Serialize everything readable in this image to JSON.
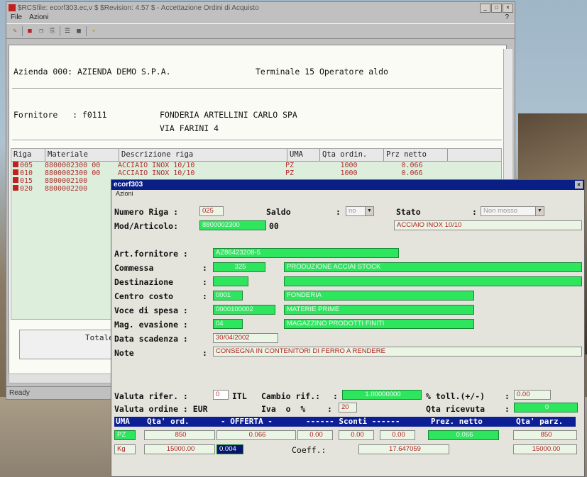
{
  "window": {
    "title": "$RCSfile: ecorf303.ec,v $ $Revision: 4.57 $ - Accettazione Ordini di Acquisto",
    "btn_min": "_",
    "btn_max": "□",
    "btn_close": "×",
    "help_mark": "?"
  },
  "menu": {
    "file": "File",
    "azioni": "Azioni"
  },
  "toolbar": {
    "icons": [
      "save-icon",
      "stop-icon",
      "copy-icon",
      "paste-icon",
      "find-icon",
      "grid-icon",
      "help-icon"
    ]
  },
  "header": {
    "azienda": "Azienda 000: AZIENDA DEMO S.P.A.",
    "terminale": "Terminale 15 Operatore aldo",
    "fornitore_label": "Fornitore   : f0111",
    "fornitore_name": "FONDERIA ARTELLINI CARLO SPA",
    "fornitore_addr": "VIA FARINI 4"
  },
  "grid": {
    "columns": [
      "Riga",
      "Materiale",
      "Descrizione riga",
      "UMA",
      "Qta ordin.",
      "Prz netto"
    ],
    "rows": [
      {
        "riga": "005",
        "materiale": "8800002300 00",
        "descr": "ACCIAIO INOX 10/10",
        "uma": "PZ",
        "qta": "1000",
        "prz": "0.066"
      },
      {
        "riga": "010",
        "materiale": "8800002300 00",
        "descr": "ACCIAIO INOX 10/10",
        "uma": "PZ",
        "qta": "1000",
        "prz": "0.066"
      },
      {
        "riga": "015",
        "materiale": "8800002100",
        "descr": "",
        "uma": "",
        "qta": "",
        "prz": ""
      },
      {
        "riga": "020",
        "materiale": "8800002200",
        "descr": "",
        "uma": "",
        "qta": "",
        "prz": ""
      }
    ],
    "totale": "Totale"
  },
  "status": "Ready",
  "dialog": {
    "title": "ecorf303",
    "menu": "Azioni",
    "close": "×",
    "numero_riga_label": "Numero Riga :",
    "numero_riga": "025",
    "saldo_label": "Saldo",
    "saldo": "no",
    "stato_label": "Stato",
    "stato": "Non mosso",
    "mod_label": "Mod/Articolo:",
    "mod_value": "8800002300",
    "mod_suffix": "00",
    "mod_desc": "ACCIAIO INOX 10/10",
    "art_label": "Art.fornitore :",
    "art_value": "AZ86423208-5",
    "commessa_label": "Commessa",
    "commessa_code": "325",
    "commessa_desc": "PRODUZIONE ACCIAI STOCK",
    "destinazione_label": "Destinazione",
    "centro_label": "Centro costo",
    "centro_code": "0001",
    "centro_desc": "FONDERIA",
    "voce_label": "Voce di spesa :",
    "voce_code": "0000100002",
    "voce_desc": "MATERIE PRIME",
    "mag_label": "Mag. evasione :",
    "mag_code": "04",
    "mag_desc": "MAGAZZINO PRODOTTI FINITI",
    "data_label": "Data scadenza :",
    "data_value": "30/04/2002",
    "note_label": "Note",
    "note_value": "CONSEGNA IN CONTENITORI DI FERRO A RENDERE",
    "colon": ":",
    "valuta_rif_label": "Valuta rifer. :",
    "valuta_rif": "0",
    "valuta_rif_code": "ITL",
    "cambio_label": "Cambio rif.:",
    "cambio_value": "1.00000000",
    "toll_label": "% toll.(+/-)",
    "toll_value": "0.00",
    "valuta_ord_label": "Valuta ordine : EUR",
    "iva_label": "Iva  o  %",
    "iva_value": "20",
    "qta_ric_label": "Qta ricevuta",
    "qta_ric_value": "0",
    "table_headers": [
      "UMA",
      "Qta' ord.",
      "- OFFERTA -",
      "------ Sconti ------",
      "Prez. netto",
      "Qta' parz."
    ],
    "row1": {
      "uma": "PZ",
      "qta": "850",
      "offerta": "0.066",
      "sc1": "0.00",
      "sc2": "0.00",
      "sc3": "0.00",
      "prez": "0.066",
      "parz": "850"
    },
    "row2": {
      "uma": "Kg",
      "qta": "15000.00",
      "offerta": "0.004",
      "coeff_label": "Coeff.:",
      "coeff": "17.647059",
      "parz": "15000.00"
    }
  }
}
